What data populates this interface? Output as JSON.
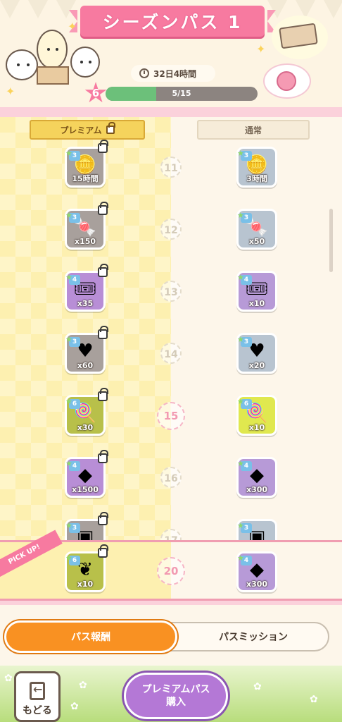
{
  "header": {
    "title": "シーズンパス 1",
    "timer": "32日4時間",
    "level": "6",
    "progress_text": "5/15",
    "progress_fraction": 0.333
  },
  "columns": {
    "premium_label": "プレミアム",
    "normal_label": "通常"
  },
  "rows": [
    {
      "level": "11",
      "premium": {
        "rarity": "3",
        "qty": "15時間",
        "icon": "coin-stack-icon",
        "style": "locked"
      },
      "normal": {
        "rarity": "3",
        "qty": "3時間",
        "icon": "coin-stack-icon",
        "style": "n-gray"
      }
    },
    {
      "level": "12",
      "premium": {
        "rarity": "3",
        "qty": "x150",
        "icon": "candy-icon",
        "style": "locked"
      },
      "normal": {
        "rarity": "3",
        "qty": "x50",
        "icon": "candy-icon",
        "style": "n-gray"
      }
    },
    {
      "level": "13",
      "premium": {
        "rarity": "4",
        "qty": "x35",
        "icon": "ticket-icon",
        "style": "p-purple"
      },
      "normal": {
        "rarity": "4",
        "qty": "x10",
        "icon": "ticket-icon",
        "style": "n-purple"
      }
    },
    {
      "level": "14",
      "premium": {
        "rarity": "3",
        "qty": "x60",
        "icon": "heart-icon",
        "style": "locked"
      },
      "normal": {
        "rarity": "3",
        "qty": "x20",
        "icon": "heart-icon",
        "style": "n-gray"
      }
    },
    {
      "level": "15",
      "premium": {
        "rarity": "6",
        "qty": "x30",
        "icon": "lollipop-icon",
        "style": "p-yellow"
      },
      "normal": {
        "rarity": "6",
        "qty": "x10",
        "icon": "lollipop-icon",
        "style": "n-yellow"
      }
    },
    {
      "level": "16",
      "premium": {
        "rarity": "4",
        "qty": "x1500",
        "icon": "gem-icon",
        "style": "p-purple"
      },
      "normal": {
        "rarity": "4",
        "qty": "x300",
        "icon": "gem-icon",
        "style": "n-purple"
      }
    },
    {
      "level": "17",
      "premium": {
        "rarity": "3",
        "qty": "",
        "icon": "item-icon",
        "style": "locked"
      },
      "normal": {
        "rarity": "3",
        "qty": "",
        "icon": "item-icon",
        "style": "n-gray"
      }
    }
  ],
  "pickup": {
    "ribbon": "PICK UP!",
    "level": "20",
    "premium": {
      "rarity": "6",
      "qty": "x10",
      "icon": "branch-icon",
      "style": "p-yellow"
    },
    "normal": {
      "rarity": "4",
      "qty": "x300",
      "icon": "gem-icon",
      "style": "n-purple"
    }
  },
  "tabs": {
    "active": "パス報酬",
    "inactive": "パスミッション"
  },
  "bottom": {
    "back_label": "もどる",
    "premium_line1": "プレミアムパス",
    "premium_line2": "購入"
  }
}
